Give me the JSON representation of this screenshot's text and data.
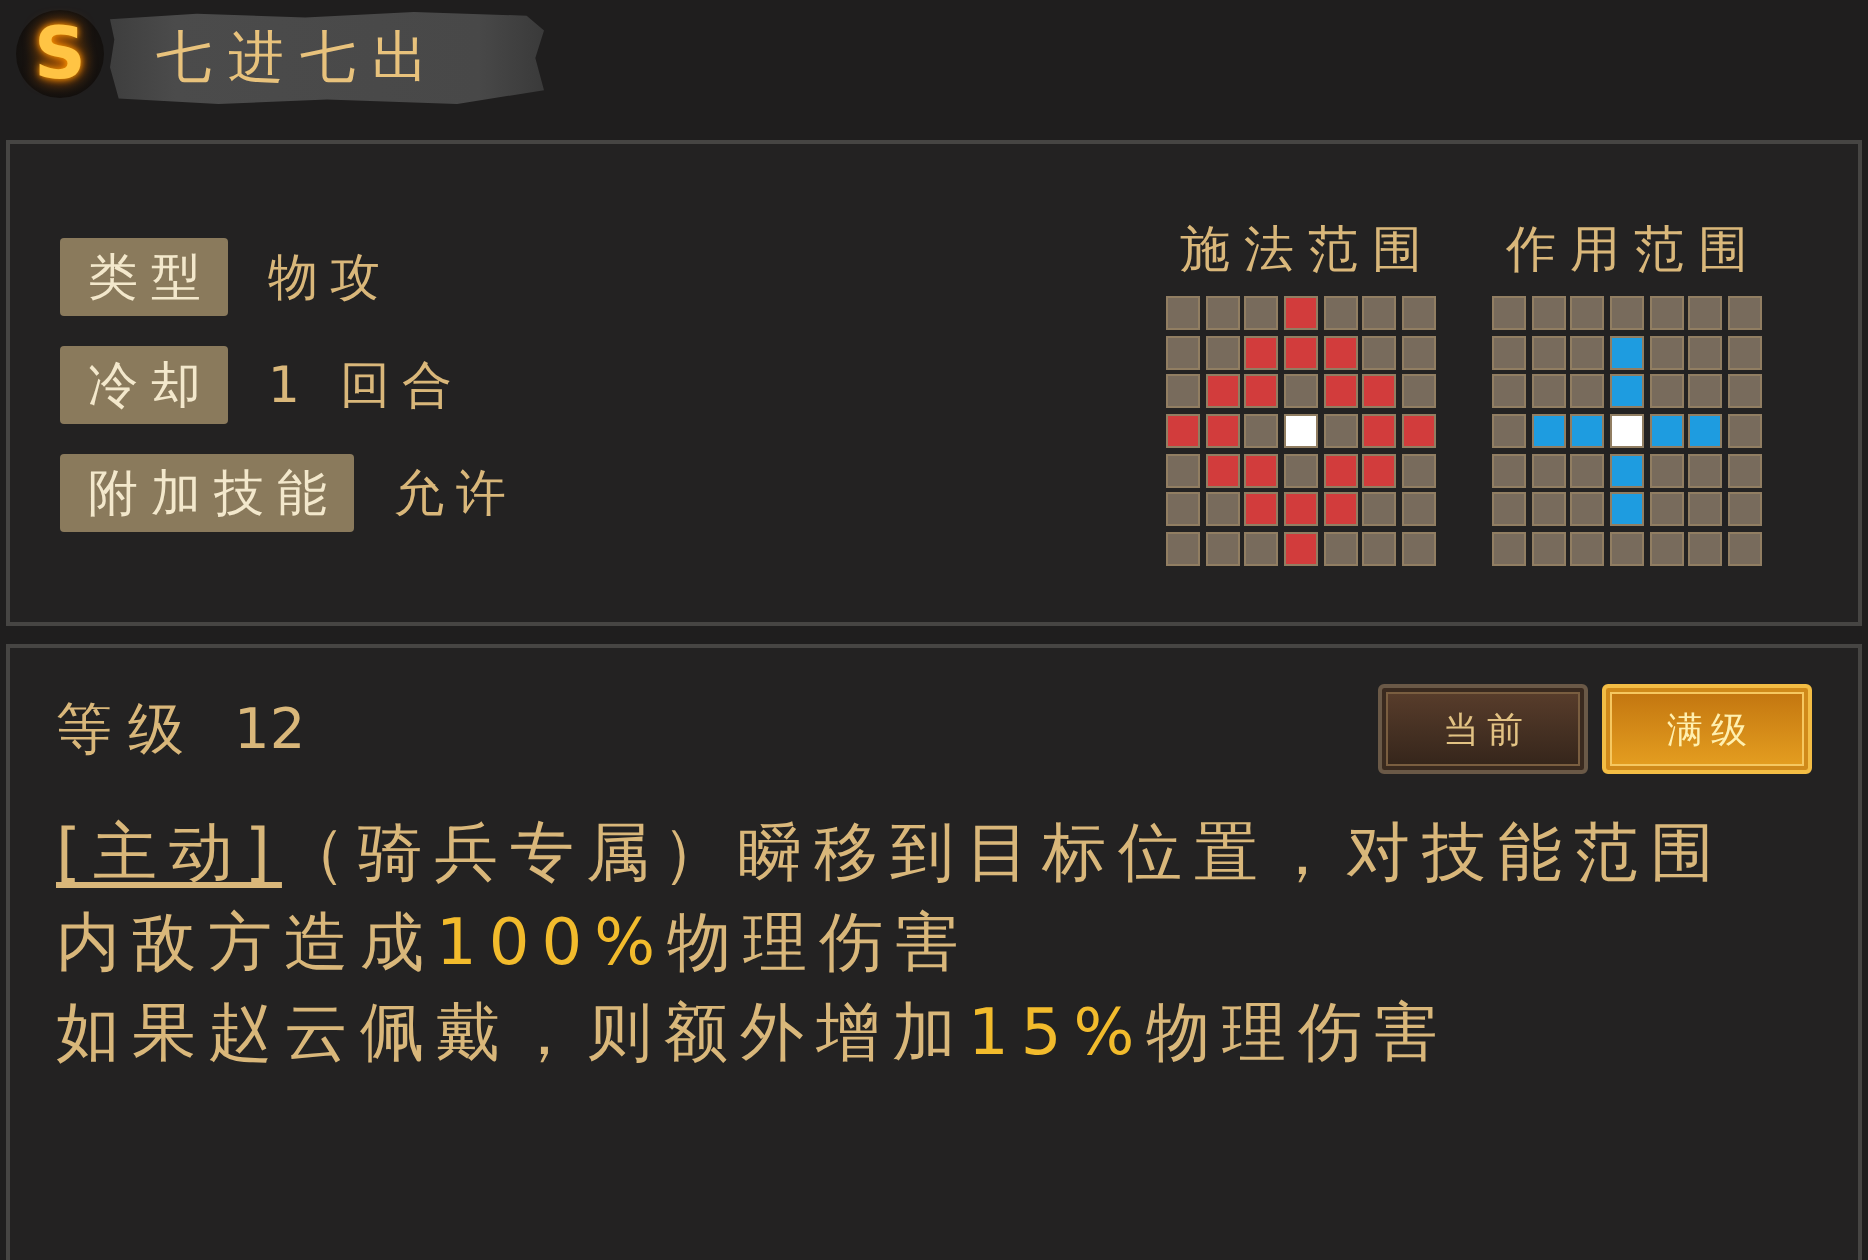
{
  "header": {
    "badge": "S",
    "title": "七进七出"
  },
  "info": [
    {
      "label": "类型",
      "value": "物攻"
    },
    {
      "label": "冷却",
      "value": "1 回合"
    },
    {
      "label": "附加技能",
      "value": "允许"
    }
  ],
  "ranges": [
    {
      "title": "施法范围",
      "color": "#d23c3c",
      "rows": [
        [
          {
            "kind": "empty"
          },
          {
            "kind": "empty"
          },
          {
            "kind": "empty"
          },
          {
            "kind": "area"
          },
          {
            "kind": "empty"
          },
          {
            "kind": "empty"
          },
          {
            "kind": "empty"
          }
        ],
        [
          {
            "kind": "empty"
          },
          {
            "kind": "empty"
          },
          {
            "kind": "area"
          },
          {
            "kind": "area"
          },
          {
            "kind": "area"
          },
          {
            "kind": "empty"
          },
          {
            "kind": "empty"
          }
        ],
        [
          {
            "kind": "empty"
          },
          {
            "kind": "area"
          },
          {
            "kind": "area"
          },
          {
            "kind": "empty"
          },
          {
            "kind": "area"
          },
          {
            "kind": "area"
          },
          {
            "kind": "empty"
          }
        ],
        [
          {
            "kind": "area"
          },
          {
            "kind": "area"
          },
          {
            "kind": "empty"
          },
          {
            "kind": "origin"
          },
          {
            "kind": "empty"
          },
          {
            "kind": "area"
          },
          {
            "kind": "area"
          }
        ],
        [
          {
            "kind": "empty"
          },
          {
            "kind": "area"
          },
          {
            "kind": "area"
          },
          {
            "kind": "empty"
          },
          {
            "kind": "area"
          },
          {
            "kind": "area"
          },
          {
            "kind": "empty"
          }
        ],
        [
          {
            "kind": "empty"
          },
          {
            "kind": "empty"
          },
          {
            "kind": "area"
          },
          {
            "kind": "area"
          },
          {
            "kind": "area"
          },
          {
            "kind": "empty"
          },
          {
            "kind": "empty"
          }
        ],
        [
          {
            "kind": "empty"
          },
          {
            "kind": "empty"
          },
          {
            "kind": "empty"
          },
          {
            "kind": "area"
          },
          {
            "kind": "empty"
          },
          {
            "kind": "empty"
          },
          {
            "kind": "empty"
          }
        ]
      ]
    },
    {
      "title": "作用范围",
      "color": "#1e9ce0",
      "rows": [
        [
          {
            "kind": "empty"
          },
          {
            "kind": "empty"
          },
          {
            "kind": "empty"
          },
          {
            "kind": "empty"
          },
          {
            "kind": "empty"
          },
          {
            "kind": "empty"
          },
          {
            "kind": "empty"
          }
        ],
        [
          {
            "kind": "empty"
          },
          {
            "kind": "empty"
          },
          {
            "kind": "empty"
          },
          {
            "kind": "area"
          },
          {
            "kind": "empty"
          },
          {
            "kind": "empty"
          },
          {
            "kind": "empty"
          }
        ],
        [
          {
            "kind": "empty"
          },
          {
            "kind": "empty"
          },
          {
            "kind": "empty"
          },
          {
            "kind": "area"
          },
          {
            "kind": "empty"
          },
          {
            "kind": "empty"
          },
          {
            "kind": "empty"
          }
        ],
        [
          {
            "kind": "empty"
          },
          {
            "kind": "area"
          },
          {
            "kind": "area"
          },
          {
            "kind": "origin"
          },
          {
            "kind": "area"
          },
          {
            "kind": "area"
          },
          {
            "kind": "empty"
          }
        ],
        [
          {
            "kind": "empty"
          },
          {
            "kind": "empty"
          },
          {
            "kind": "empty"
          },
          {
            "kind": "area"
          },
          {
            "kind": "empty"
          },
          {
            "kind": "empty"
          },
          {
            "kind": "empty"
          }
        ],
        [
          {
            "kind": "empty"
          },
          {
            "kind": "empty"
          },
          {
            "kind": "empty"
          },
          {
            "kind": "area"
          },
          {
            "kind": "empty"
          },
          {
            "kind": "empty"
          },
          {
            "kind": "empty"
          }
        ],
        [
          {
            "kind": "empty"
          },
          {
            "kind": "empty"
          },
          {
            "kind": "empty"
          },
          {
            "kind": "empty"
          },
          {
            "kind": "empty"
          },
          {
            "kind": "empty"
          },
          {
            "kind": "empty"
          }
        ]
      ]
    }
  ],
  "level": {
    "label": "等级",
    "value": "12"
  },
  "level_tabs": [
    {
      "label": "当前",
      "selected": false
    },
    {
      "label": "满级",
      "selected": true
    }
  ],
  "description": [
    {
      "tag": "[主动]",
      "text": "（骑兵专属）瞬移到目标位置，对技能范围内敌方造成**100%**物理伤害"
    },
    {
      "text": "如果赵云佩戴，则额外增加**15%**物理伤害"
    }
  ]
}
